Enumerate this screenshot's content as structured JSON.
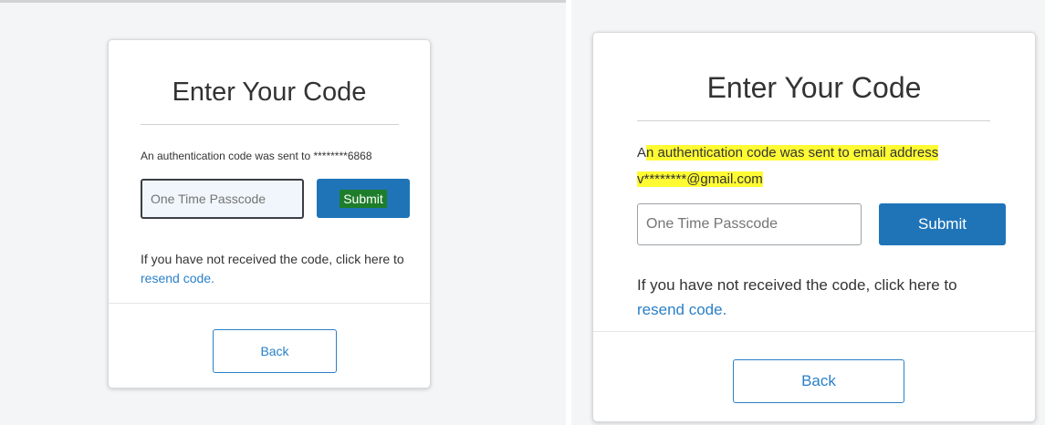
{
  "left_card": {
    "title": "Enter Your Code",
    "message": "An authentication code was sent to ********6868",
    "otp_placeholder": "One Time Passcode",
    "submit_label": "Submit",
    "resend_text": "If you have not received the code, click here to ",
    "resend_link": "resend code.",
    "back_label": "Back"
  },
  "right_card": {
    "title": "Enter Your Code",
    "message_prefix": "A",
    "message_rest": "n authentication code was sent to email address",
    "email": "v********@gmail.com",
    "otp_placeholder": "One Time Passcode",
    "submit_label": "Submit",
    "resend_text": "If you have not received the code, click here to ",
    "resend_link": "resend code.",
    "back_label": "Back"
  },
  "colors": {
    "primary": "#1f74b8",
    "link": "#2a80c8",
    "highlight": "#fffb33",
    "highlight_green": "#1e7d2a"
  }
}
